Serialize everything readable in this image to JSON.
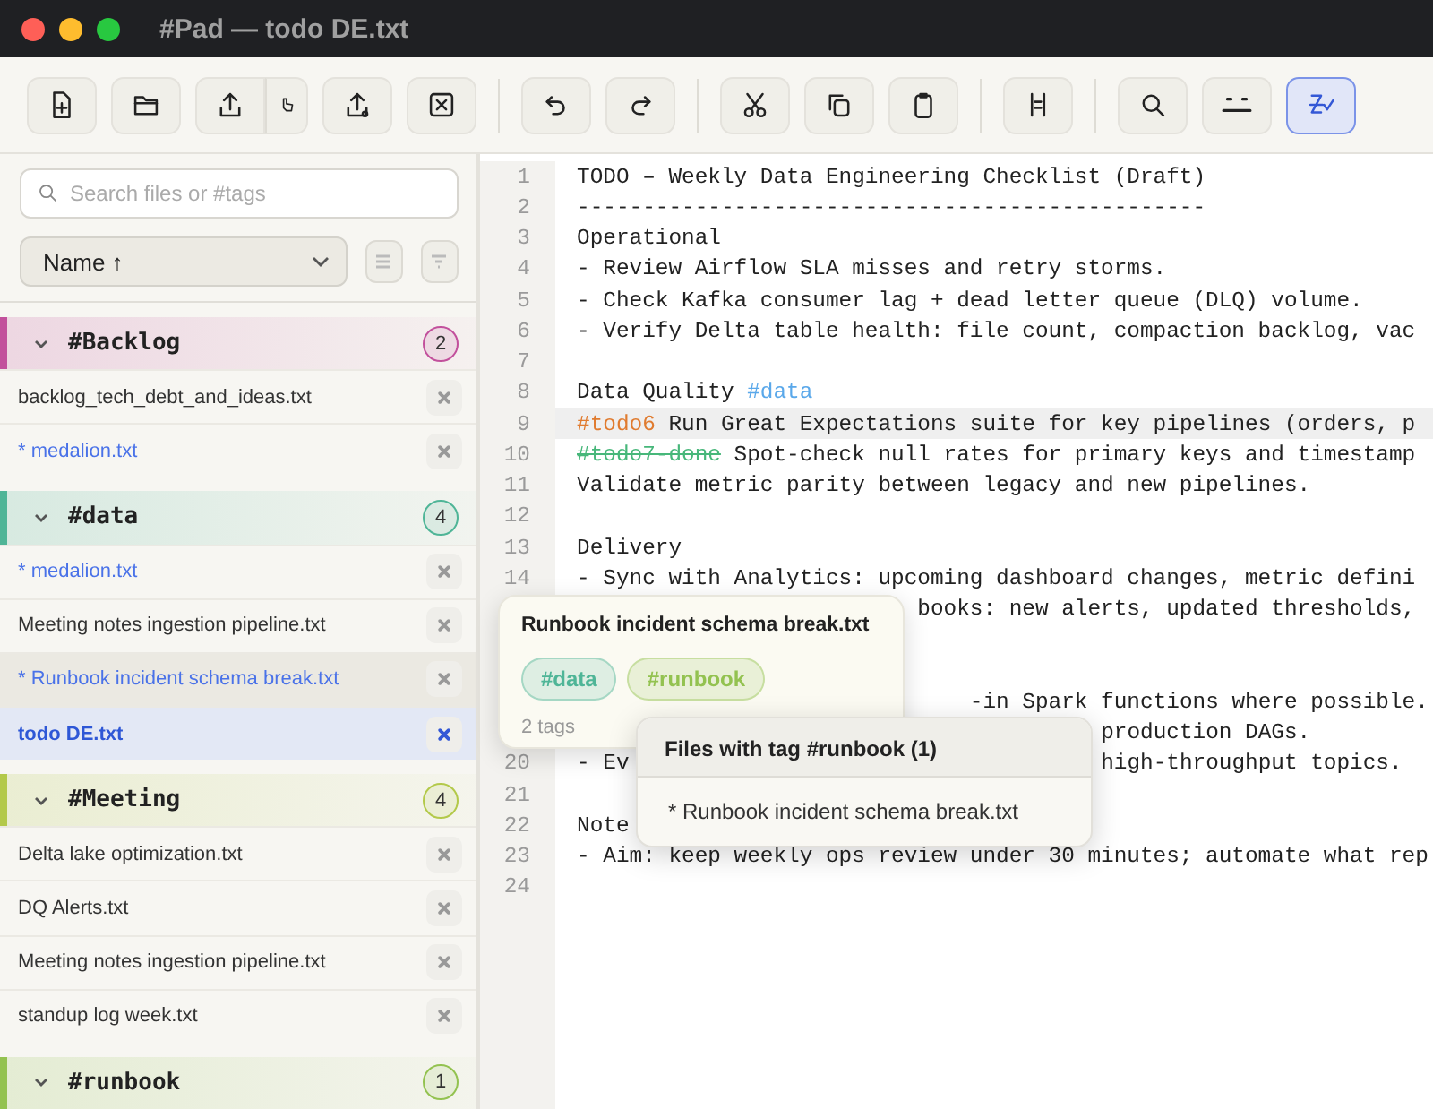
{
  "window": {
    "title": "#Pad — todo DE.txt"
  },
  "toolbar": {
    "groups": [
      [
        {
          "kind": "new-file",
          "active": false
        },
        {
          "kind": "folder",
          "active": false
        },
        {
          "kind": "export-split",
          "active": false
        },
        {
          "kind": "upload",
          "active": false
        },
        {
          "kind": "close-box",
          "active": false
        }
      ],
      [
        {
          "kind": "undo",
          "active": false
        },
        {
          "kind": "redo",
          "active": false
        }
      ],
      [
        {
          "kind": "cut",
          "active": false
        },
        {
          "kind": "copy",
          "active": false
        },
        {
          "kind": "paste",
          "active": false
        }
      ],
      [
        {
          "kind": "columns",
          "active": false
        }
      ],
      [
        {
          "kind": "search",
          "active": false
        },
        {
          "kind": "dots",
          "active": false
        },
        {
          "kind": "spell",
          "active": true
        }
      ]
    ]
  },
  "sidebar": {
    "search": {
      "placeholder": "Search files or #tags"
    },
    "sort": {
      "value": "Name ↑"
    },
    "groups": [
      {
        "tag": "#Backlog",
        "count": "2",
        "color": "#c2509c",
        "expanded": true,
        "files": [
          {
            "name": "backlog_tech_debt_and_ideas.txt",
            "modified": false,
            "selected": false,
            "hovered": false
          },
          {
            "name": "* medalion.txt",
            "modified": true,
            "selected": false,
            "hovered": false
          }
        ]
      },
      {
        "tag": "#data",
        "count": "4",
        "color": "#4fb597",
        "expanded": true,
        "files": [
          {
            "name": "* medalion.txt",
            "modified": true,
            "selected": false,
            "hovered": false
          },
          {
            "name": "Meeting notes ingestion pipeline.txt",
            "modified": false,
            "selected": false,
            "hovered": false
          },
          {
            "name": "* Runbook incident schema break.txt",
            "modified": true,
            "selected": false,
            "hovered": true
          },
          {
            "name": "todo DE.txt",
            "modified": false,
            "selected": true,
            "hovered": false
          }
        ]
      },
      {
        "tag": "#Meeting",
        "count": "4",
        "color": "#b3c94a",
        "expanded": true,
        "files": [
          {
            "name": "Delta lake optimization.txt",
            "modified": false,
            "selected": false,
            "hovered": false
          },
          {
            "name": "DQ Alerts.txt",
            "modified": false,
            "selected": false,
            "hovered": false
          },
          {
            "name": "Meeting notes ingestion pipeline.txt",
            "modified": false,
            "selected": false,
            "hovered": false
          },
          {
            "name": "standup log week.txt",
            "modified": false,
            "selected": false,
            "hovered": false
          }
        ]
      },
      {
        "tag": "#runbook",
        "count": "1",
        "color": "#93c250",
        "expanded": true
      }
    ]
  },
  "editor": {
    "lines": [
      {
        "number": "1",
        "selected": false,
        "segments": [
          {
            "kind": "text",
            "text": "TODO – Weekly Data Engineering Checklist (Draft)"
          }
        ]
      },
      {
        "number": "2",
        "selected": false,
        "segments": [
          {
            "kind": "text",
            "text": "------------------------------------------------"
          }
        ]
      },
      {
        "number": "3",
        "selected": false,
        "segments": [
          {
            "kind": "text",
            "text": "Operational"
          }
        ]
      },
      {
        "number": "4",
        "selected": false,
        "segments": [
          {
            "kind": "text",
            "text": "- Review Airflow SLA misses and retry storms."
          }
        ]
      },
      {
        "number": "5",
        "selected": false,
        "segments": [
          {
            "kind": "text",
            "text": "- Check Kafka consumer lag + dead letter queue (DLQ) volume."
          }
        ]
      },
      {
        "number": "6",
        "selected": false,
        "segments": [
          {
            "kind": "text",
            "text": "- Verify Delta table health: file count, compaction backlog, vac"
          }
        ]
      },
      {
        "number": "7",
        "selected": false
      },
      {
        "number": "8",
        "selected": false,
        "segments": [
          {
            "kind": "text",
            "text": "Data Quality "
          },
          {
            "kind": "tag",
            "text": "#data"
          }
        ]
      },
      {
        "number": "9",
        "selected": true,
        "segments": [
          {
            "kind": "todo",
            "text": "#todo6"
          },
          {
            "kind": "text",
            "text": " Run Great Expectations suite for key pipelines (orders, p"
          }
        ]
      },
      {
        "number": "10",
        "selected": false,
        "segments": [
          {
            "kind": "done",
            "text": "#todo7-done"
          },
          {
            "kind": "text",
            "text": " Spot-check null rates for primary keys and timestamp"
          }
        ]
      },
      {
        "number": "11",
        "selected": false,
        "segments": [
          {
            "kind": "text",
            "text": "Validate metric parity between legacy and new pipelines."
          }
        ]
      },
      {
        "number": "12",
        "selected": false
      },
      {
        "number": "13",
        "selected": false,
        "segments": [
          {
            "kind": "text",
            "text": "Delivery"
          }
        ]
      },
      {
        "number": "14",
        "selected": false,
        "segments": [
          {
            "kind": "text",
            "text": "- Sync with Analytics: upcoming dashboard changes, metric defini"
          }
        ]
      },
      {
        "selected": false,
        "segments": [
          {
            "kind": "text",
            "text": "                          books: new alerts, updated thresholds,"
          }
        ]
      },
      {
        "selected": false
      },
      {
        "selected": false
      },
      {
        "selected": false,
        "segments": [
          {
            "kind": "text",
            "text": "                              -in Spark functions where possible."
          }
        ]
      },
      {
        "selected": false,
        "segments": [
          {
            "kind": "text",
            "text": "                                        production DAGs."
          }
        ]
      },
      {
        "number": "20",
        "selected": false,
        "segments": [
          {
            "kind": "text",
            "text": "- Ev"
          },
          {
            "kind": "text",
            "text": "                                    high-throughput topics."
          }
        ]
      },
      {
        "number": "21",
        "selected": false
      },
      {
        "number": "22",
        "selected": false,
        "segments": [
          {
            "kind": "text",
            "text": "Note"
          }
        ]
      },
      {
        "number": "23",
        "selected": false,
        "segments": [
          {
            "kind": "text",
            "text": "- Aim: keep weekly ops review under 30 minutes; automate what rep"
          }
        ]
      },
      {
        "number": "24",
        "selected": false
      }
    ]
  },
  "file_tooltip": {
    "title": "Runbook incident schema break.txt",
    "tags": [
      {
        "label": "#data",
        "color": "#4fb597"
      },
      {
        "label": "#runbook",
        "color": "#93c250"
      }
    ],
    "count": "2 tags"
  },
  "tag_popup": {
    "title": "Files with tag #runbook (1)",
    "files": [
      "* Runbook incident schema break.txt"
    ]
  }
}
